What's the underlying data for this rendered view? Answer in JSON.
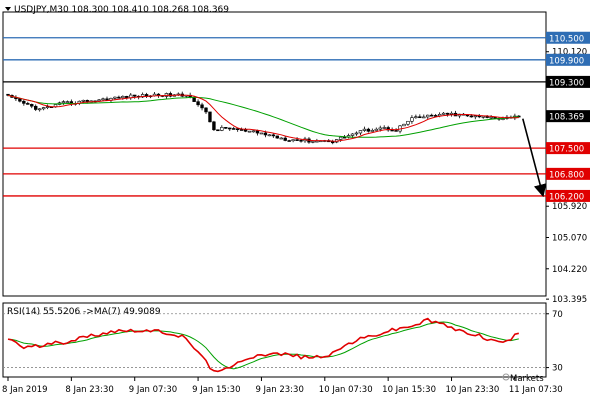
{
  "chart_data": [
    {
      "type": "candlestick",
      "symbol_line": "USDJPY,M30  108.300 108.410 108.268 108.369",
      "ylim": [
        103.48,
        111.2
      ],
      "y_ticks": [
        "110.120",
        "105.920",
        "105.070",
        "104.220",
        "103.395"
      ],
      "y_tick_values": [
        110.12,
        105.92,
        105.07,
        104.22,
        103.395
      ],
      "x_ticks": [
        "8 Jan 2019",
        "8 Jan 23:30",
        "9 Jan 07:30",
        "9 Jan 15:30",
        "9 Jan 23:30",
        "10 Jan 07:30",
        "10 Jan 15:30",
        "10 Jan 23:30",
        "11 Jan 07:30"
      ],
      "x_tick_bars": [
        0,
        16,
        32,
        48,
        64,
        80,
        96,
        112,
        128
      ],
      "num_bars": 130,
      "current_price": {
        "value": 108.369,
        "label": "108.369",
        "color": "#000000"
      },
      "levels": [
        {
          "value": 110.5,
          "label": "110.500",
          "color": "#2e6db4"
        },
        {
          "value": 109.9,
          "label": "109.900",
          "color": "#2e6db4"
        },
        {
          "value": 109.3,
          "label": "109.300",
          "color": "#000000"
        },
        {
          "value": 107.5,
          "label": "107.500",
          "color": "#e00000"
        },
        {
          "value": 106.8,
          "label": "106.800",
          "color": "#e00000"
        },
        {
          "value": 106.2,
          "label": "106.200",
          "color": "#e00000"
        }
      ],
      "close_anchors": [
        [
          0,
          108.9
        ],
        [
          3,
          108.75
        ],
        [
          8,
          108.55
        ],
        [
          14,
          108.72
        ],
        [
          22,
          108.8
        ],
        [
          30,
          108.9
        ],
        [
          38,
          108.95
        ],
        [
          46,
          108.92
        ],
        [
          50,
          108.45
        ],
        [
          52,
          108.0
        ],
        [
          56,
          108.05
        ],
        [
          60,
          107.95
        ],
        [
          64,
          107.9
        ],
        [
          70,
          107.75
        ],
        [
          76,
          107.7
        ],
        [
          82,
          107.7
        ],
        [
          86,
          107.85
        ],
        [
          90,
          107.98
        ],
        [
          94,
          108.05
        ],
        [
          98,
          108.0
        ],
        [
          102,
          108.3
        ],
        [
          108,
          108.4
        ],
        [
          112,
          108.42
        ],
        [
          118,
          108.35
        ],
        [
          124,
          108.32
        ],
        [
          129,
          108.369
        ]
      ],
      "ma_fast_color": "#e00000",
      "ma_slow_color": "#00a000",
      "arrow": {
        "from_bar": 130,
        "from_price": 108.3,
        "to_bar": 135,
        "to_price": 106.25
      }
    },
    {
      "type": "line",
      "title": "RSI(14) 55.5206 ->MA(7) 49.9089",
      "ylim": [
        23,
        78
      ],
      "y_ticks": [
        "70",
        "30"
      ],
      "y_tick_values": [
        70,
        30
      ],
      "levels": [
        70,
        30
      ],
      "rsi_anchors": [
        [
          0,
          52
        ],
        [
          4,
          45
        ],
        [
          8,
          46
        ],
        [
          14,
          49
        ],
        [
          20,
          53
        ],
        [
          26,
          57
        ],
        [
          32,
          58
        ],
        [
          40,
          56
        ],
        [
          44,
          53
        ],
        [
          48,
          42
        ],
        [
          51,
          30
        ],
        [
          54,
          27
        ],
        [
          57,
          31
        ],
        [
          60,
          37
        ],
        [
          64,
          40
        ],
        [
          70,
          40
        ],
        [
          76,
          37
        ],
        [
          82,
          40
        ],
        [
          86,
          48
        ],
        [
          90,
          52
        ],
        [
          96,
          57
        ],
        [
          102,
          61
        ],
        [
          106,
          65
        ],
        [
          110,
          62
        ],
        [
          114,
          57
        ],
        [
          118,
          55
        ],
        [
          122,
          50
        ],
        [
          126,
          49
        ],
        [
          129,
          55.5
        ]
      ],
      "rsi_color": "#e00000",
      "rsi_ma_color": "#00a000"
    }
  ],
  "watermark": "Markets"
}
